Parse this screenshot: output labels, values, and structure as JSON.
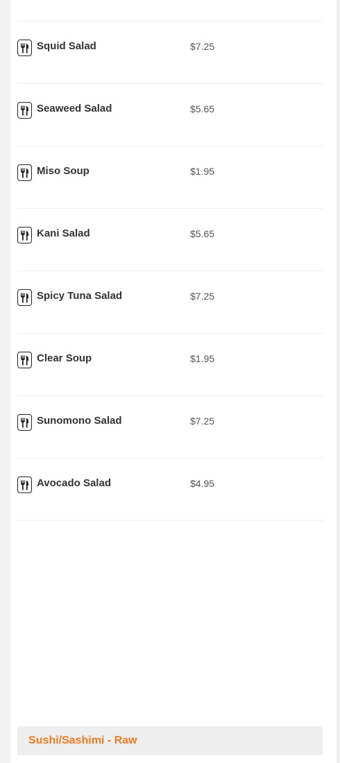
{
  "menu": {
    "items": [
      {
        "name": "Squid Salad",
        "price": "$7.25",
        "icon": "utensils-icon"
      },
      {
        "name": "Seaweed Salad",
        "price": "$5.65",
        "icon": "utensils-icon"
      },
      {
        "name": "Miso Soup",
        "price": "$1.95",
        "icon": "utensils-icon"
      },
      {
        "name": "Kani Salad",
        "price": "$5.65",
        "icon": "utensils-icon"
      },
      {
        "name": "Spicy Tuna Salad",
        "price": "$7.25",
        "icon": "utensils-icon"
      },
      {
        "name": "Clear Soup",
        "price": "$1.95",
        "icon": "utensils-icon"
      },
      {
        "name": "Sunomono Salad",
        "price": "$7.25",
        "icon": "utensils-icon"
      },
      {
        "name": "Avocado Salad",
        "price": "$4.95",
        "icon": "utensils-icon"
      }
    ]
  },
  "next_section": {
    "title": "Sushi/Sashimi - Raw"
  },
  "colors": {
    "accent": "#f47b20",
    "background": "#f0f0f0",
    "panel": "#ffffff",
    "divider": "#eeeeee"
  }
}
